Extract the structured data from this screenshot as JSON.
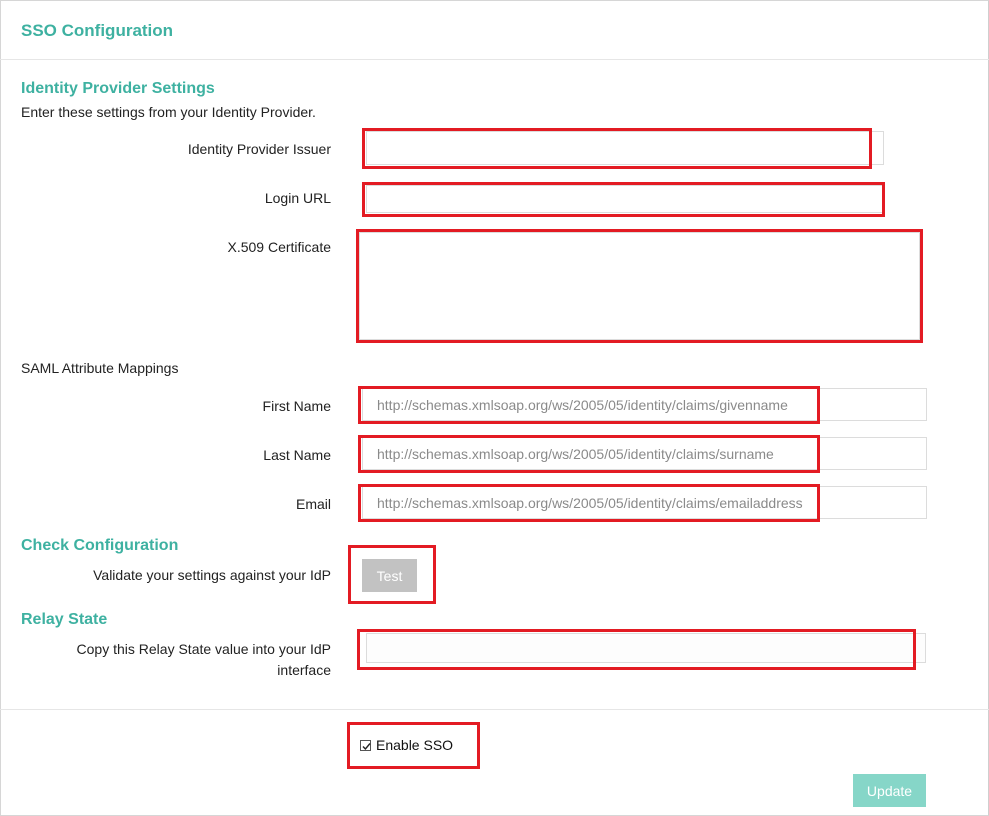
{
  "header": {
    "title": "SSO Configuration"
  },
  "idp": {
    "title": "Identity Provider Settings",
    "description": "Enter these settings from your Identity Provider.",
    "issuer_label": "Identity Provider Issuer",
    "issuer_value": "",
    "login_url_label": "Login URL",
    "login_url_value": "",
    "certificate_label": "X.509 Certificate",
    "certificate_value": ""
  },
  "saml": {
    "title": "SAML Attribute Mappings",
    "first_name_label": "First Name",
    "first_name_placeholder": "http://schemas.xmlsoap.org/ws/2005/05/identity/claims/givenname",
    "last_name_label": "Last Name",
    "last_name_placeholder": "http://schemas.xmlsoap.org/ws/2005/05/identity/claims/surname",
    "email_label": "Email",
    "email_placeholder": "http://schemas.xmlsoap.org/ws/2005/05/identity/claims/emailaddress"
  },
  "check": {
    "title": "Check Configuration",
    "label": "Validate your settings against your IdP",
    "test_button": "Test"
  },
  "relay": {
    "title": "Relay State",
    "label_line1": "Copy this Relay State value into your IdP",
    "label_line2": "interface",
    "value": ""
  },
  "footer": {
    "enable_sso_label": "Enable SSO",
    "enable_sso_checked": true,
    "update_button": "Update"
  },
  "colors": {
    "accent": "#3eb1a1",
    "highlight": "#e31b23",
    "update_button": "#86d6c8",
    "test_button": "#c2c2c2"
  }
}
